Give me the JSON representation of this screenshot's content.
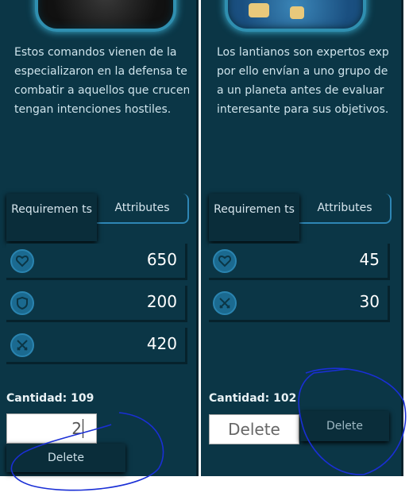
{
  "cards": [
    {
      "description_lines": [
        "Estos comandos vienen de la",
        "especializaron en la defensa te",
        "combatir a aquellos que crucen",
        "tengan intenciones hostiles."
      ],
      "tabs": {
        "requirements": "Requiremen ts",
        "attributes": "Attributes"
      },
      "attributes": [
        {
          "icon": "heart-icon",
          "value": "650"
        },
        {
          "icon": "shield-icon",
          "value": "200"
        },
        {
          "icon": "crossed-swords-icon",
          "value": "420"
        }
      ],
      "quantity_label": "Cantidad: 109",
      "quantity_input_value": "2",
      "delete_label": "Delete"
    },
    {
      "description_lines": [
        "Los lantianos son expertos exp",
        "por ello envían a uno grupo de",
        "a un planeta antes de evaluar",
        "interesante para sus objetivos."
      ],
      "tabs": {
        "requirements": "Requiremen ts",
        "attributes": "Attributes"
      },
      "attributes": [
        {
          "icon": "heart-icon",
          "value": "45"
        },
        {
          "icon": "crossed-swords-icon",
          "value": "30"
        }
      ],
      "quantity_label": "Cantidad: 102",
      "delete_input_label": "Delete",
      "delete_label": "Delete"
    }
  ],
  "colors": {
    "panel_bg": "#0b3646",
    "accent_blue": "#2e86b5",
    "annotation_ink": "#1a2fd6"
  }
}
